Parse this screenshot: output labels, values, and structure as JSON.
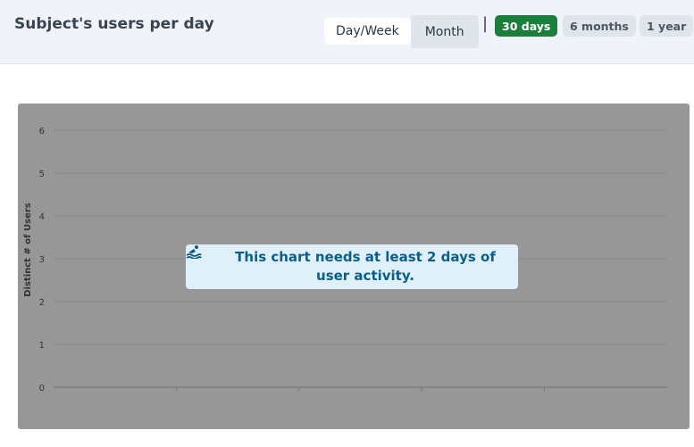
{
  "header": {
    "title": "Subject's users per day",
    "granularity_tabs": [
      {
        "label": "Day/Week",
        "active": true
      },
      {
        "label": "Month",
        "active": false
      }
    ],
    "separator": "|",
    "range_pills": [
      {
        "label": "30 days",
        "active": true
      },
      {
        "label": "6 months",
        "active": false
      },
      {
        "label": "1 year",
        "active": false
      }
    ]
  },
  "chart_data": {
    "type": "line",
    "ylabel": "Distinct # of Users",
    "xlabel": "",
    "ylim": [
      0,
      6
    ],
    "yticks": [
      "0",
      "1",
      "2",
      "3",
      "4",
      "5",
      "6"
    ],
    "x": [],
    "series": [],
    "grid": true
  },
  "notice": {
    "icon": "swimmer-icon",
    "text": "This chart needs at least 2 days of user activity."
  },
  "colors": {
    "header_bg": "#f0f3f8",
    "active_pill": "#1a7f3b",
    "overlay": "#979797",
    "notice_bg": "#dff0fb",
    "notice_text": "#0b5f86"
  }
}
